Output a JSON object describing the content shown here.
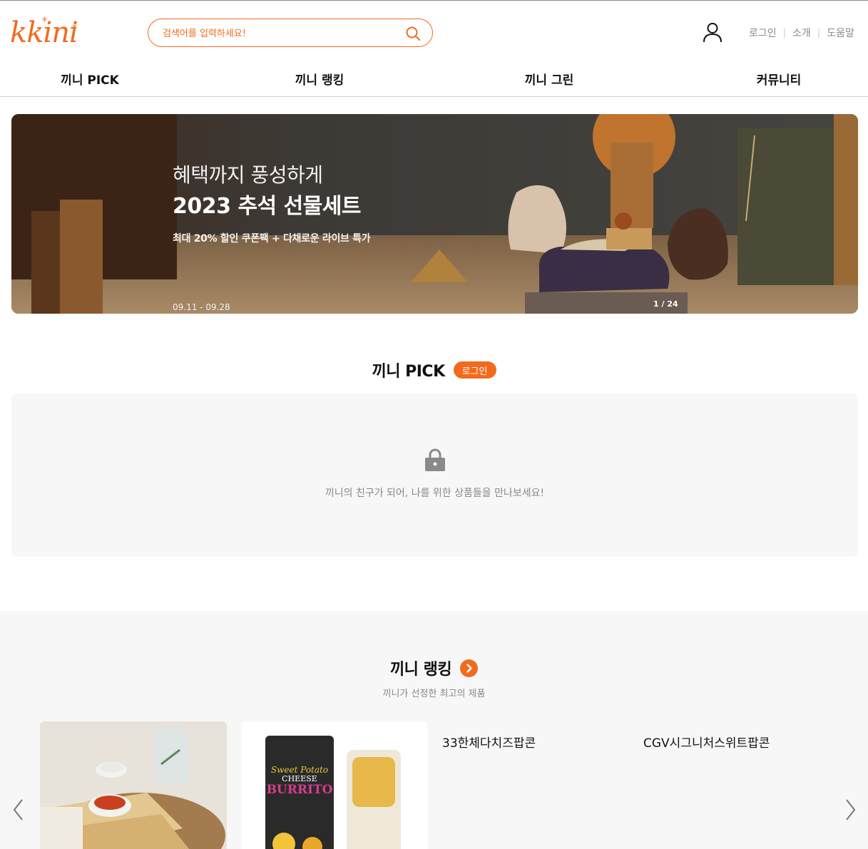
{
  "brand": {
    "logo_text": "kkini",
    "accent_color": "#f26b1d"
  },
  "header": {
    "search": {
      "placeholder": "검색어를 입력하세요!"
    },
    "util_links": [
      "로그인",
      "소개",
      "도움말"
    ]
  },
  "gnb": [
    "끼니 PICK",
    "끼니 랭킹",
    "끼니 그린",
    "커뮤니티"
  ],
  "banner": {
    "title_line1": "혜택까지 풍성하게",
    "title_line2": "2023 추석 선물세트",
    "subtitle": "최대 20% 할인 쿠폰팩 + 다채로운 라이브 특가",
    "date": "09.11 - 09.28",
    "counter": "1 / 24"
  },
  "pick": {
    "title": "끼니 PICK",
    "login_badge": "로그인",
    "message": "끼니의 친구가 되어, 나를 위한 상품들을 만나보세요!"
  },
  "ranking": {
    "title": "끼니 랭킹",
    "subtitle": "끼니가 선정한 최고의 제품",
    "products": [
      {
        "name": "",
        "image": "quesadilla-photo"
      },
      {
        "name": "",
        "image": "sweet-potato-cheese-burrito-package"
      },
      {
        "name": "33한체다치즈팝콘"
      },
      {
        "name": "CGV시그니처스위트팝콘"
      }
    ],
    "burrito_pack": {
      "line1": "Sweet Potato",
      "line2": "CHEESE",
      "line3": "BURRITO"
    }
  }
}
